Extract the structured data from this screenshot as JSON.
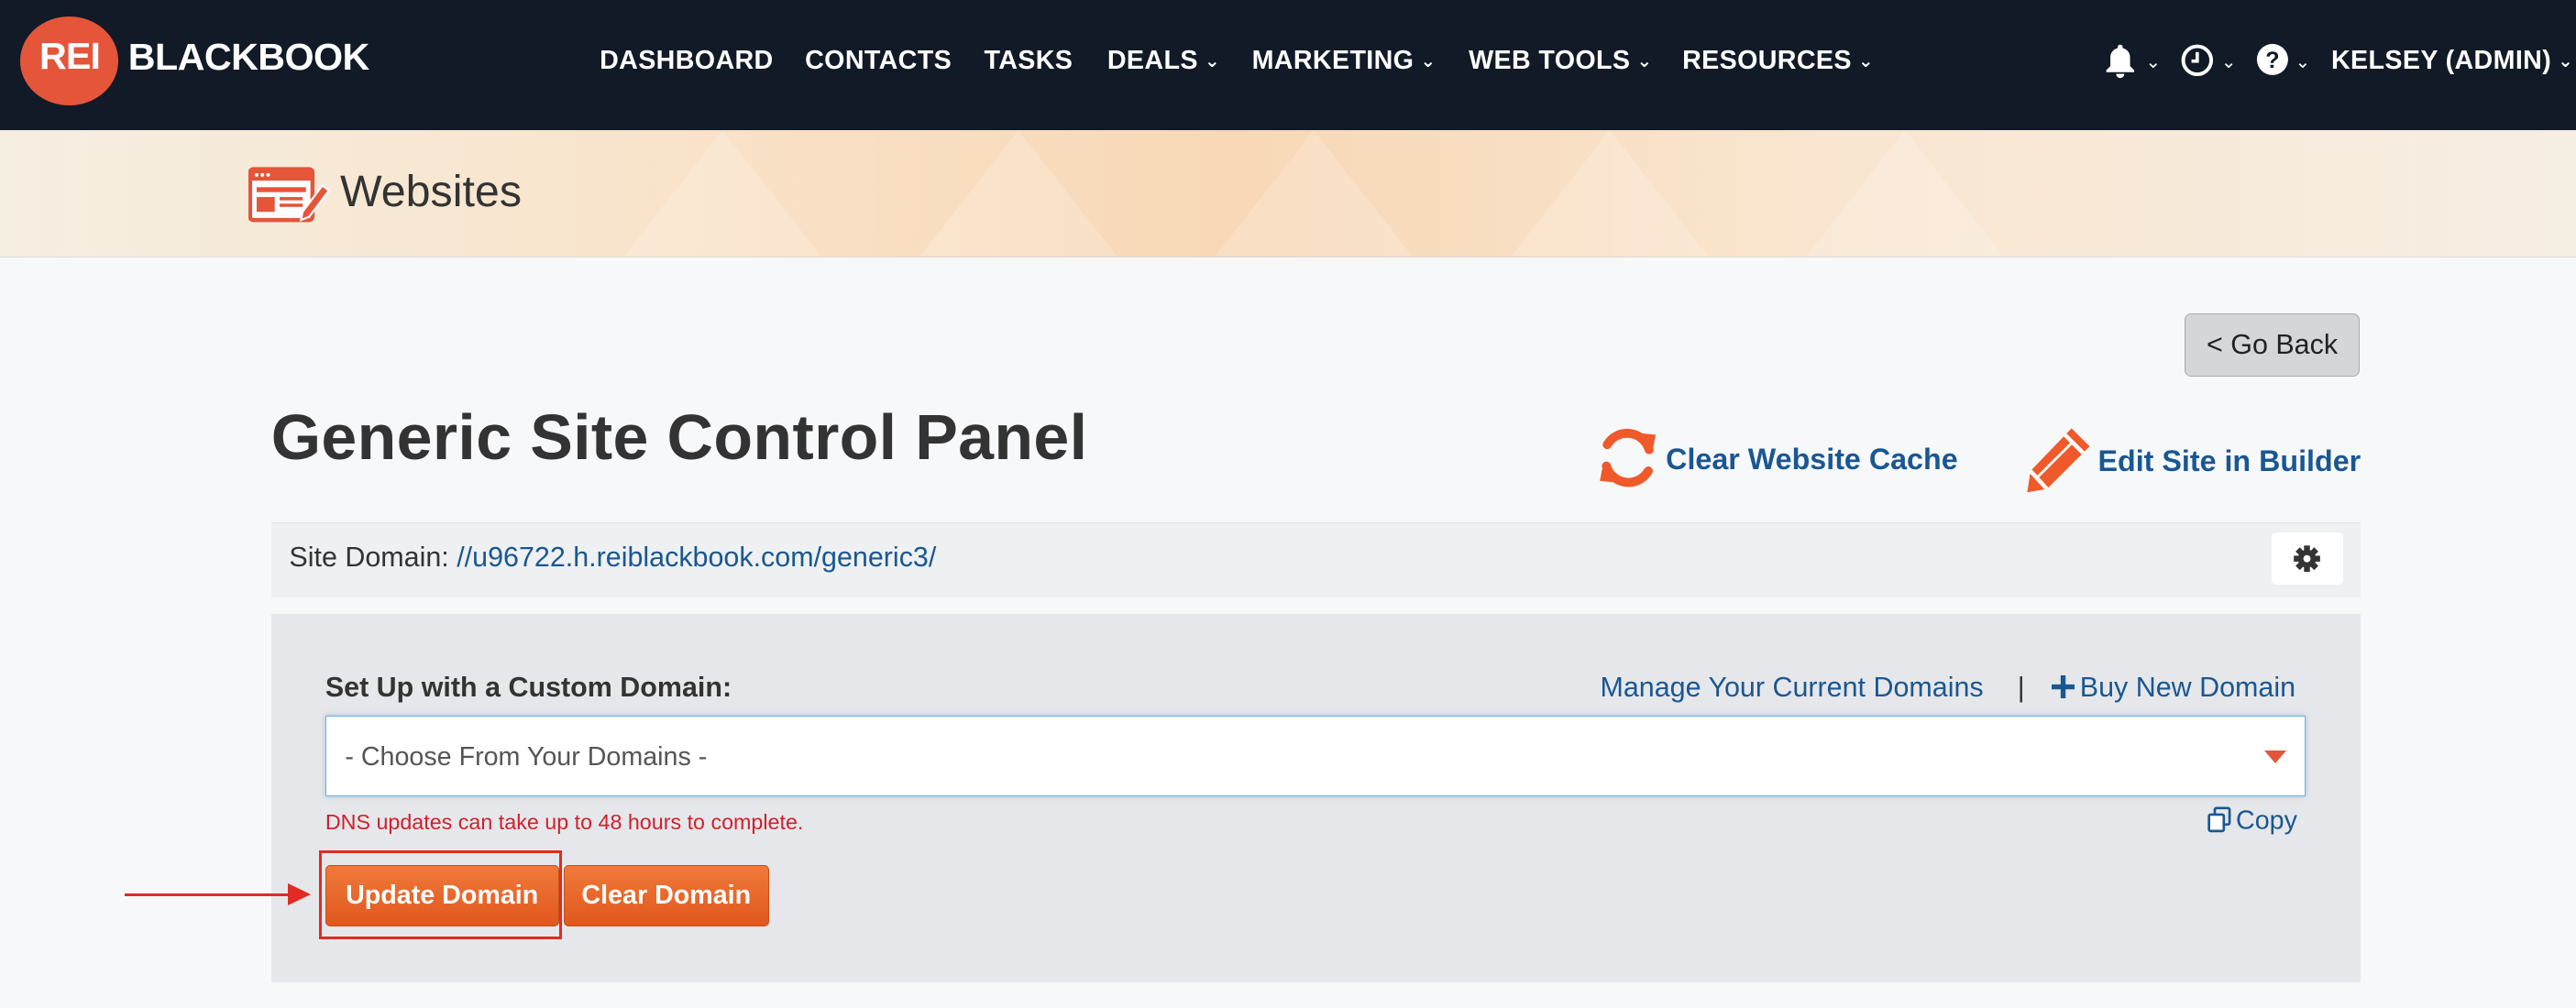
{
  "brand": {
    "logo_rei": "REI",
    "logo_word": "BLACKBOOK"
  },
  "nav": {
    "items": [
      {
        "label": "DASHBOARD",
        "dropdown": false
      },
      {
        "label": "CONTACTS",
        "dropdown": false
      },
      {
        "label": "TASKS",
        "dropdown": false
      },
      {
        "label": "DEALS",
        "dropdown": true
      },
      {
        "label": "MARKETING",
        "dropdown": true
      },
      {
        "label": "WEB TOOLS",
        "dropdown": true
      },
      {
        "label": "RESOURCES",
        "dropdown": true
      }
    ],
    "caret": "⌄",
    "user_label": "KELSEY (ADMIN)",
    "icons": [
      "bell-icon",
      "clock-icon",
      "help-icon"
    ]
  },
  "banner": {
    "title": "Websites",
    "icon": "website-edit-icon"
  },
  "page": {
    "go_back_label": "< Go Back",
    "title": "Generic Site Control Panel",
    "clear_cache_label": "Clear Website Cache",
    "edit_site_label": "Edit Site in Builder",
    "site_domain_label": "Site Domain:",
    "site_domain_url": "//u96722.h.reiblackbook.com/generic3/"
  },
  "domain_panel": {
    "setup_label": "Set Up with a Custom Domain:",
    "manage_link": "Manage Your Current Domains",
    "separator": "|",
    "buy_link": "Buy New Domain",
    "select_value": "- Choose From Your Domains -",
    "dns_note": "DNS updates can take up to 48 hours to complete.",
    "copy_label": "Copy",
    "update_button": "Update Domain",
    "clear_button": "Clear Domain"
  },
  "colors": {
    "nav_bg": "#111a26",
    "brand_orange": "#e4553a",
    "link_blue": "#1a5792",
    "button_orange": "#e8652a",
    "error_red": "#d0202c",
    "annotation_red": "#e22b22"
  }
}
